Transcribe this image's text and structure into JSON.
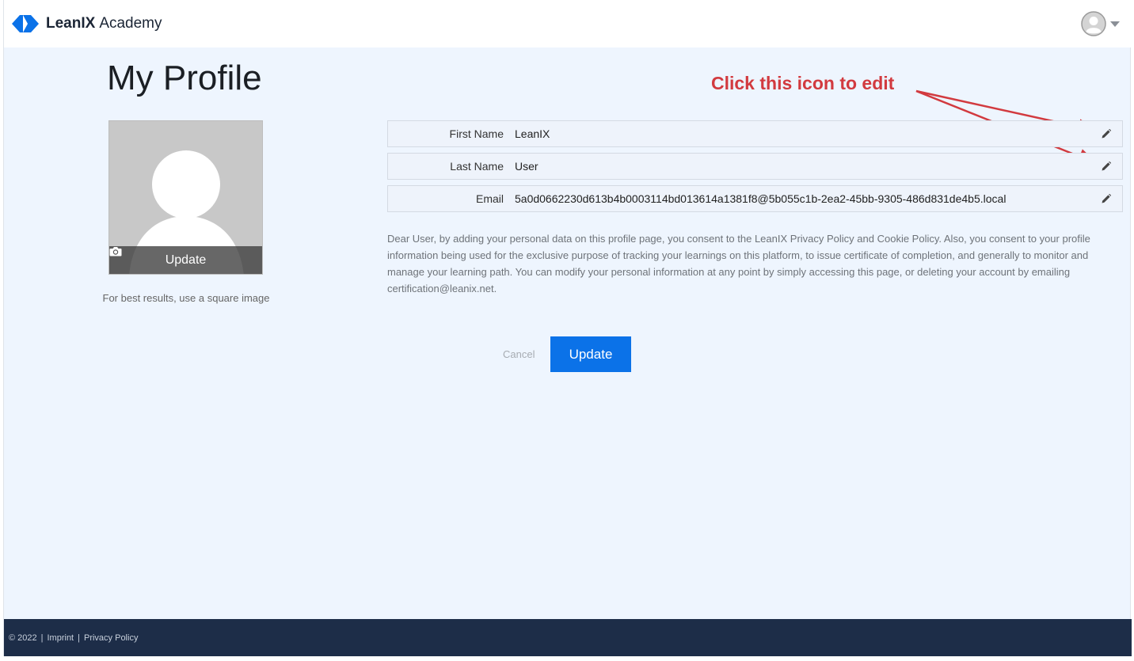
{
  "colors": {
    "brand_blue": "#0b72e8",
    "page_bg": "#eef5fe",
    "footer_bg": "#1d2d48",
    "annotation_red": "#d23a3f"
  },
  "header": {
    "brand_strong": "LeanIX",
    "brand_light": "Academy",
    "logo_icon": "leanix-logo-icon",
    "avatar_icon": "user-avatar-icon",
    "menu_icon": "caret-down-icon"
  },
  "page": {
    "title": "My Profile"
  },
  "photo": {
    "update_label": "Update",
    "camera_icon": "camera-icon",
    "hint": "For best results, use a square image"
  },
  "annotation": {
    "text": "Click this icon to edit"
  },
  "fields": [
    {
      "label": "First Name",
      "value": "LeanIX",
      "edit_icon": "pencil-icon"
    },
    {
      "label": "Last Name",
      "value": "User",
      "edit_icon": "pencil-icon"
    },
    {
      "label": "Email",
      "value": "5a0d0662230d613b4b0003114bd013614a1381f8@5b055c1b-2ea2-45bb-9305-486d831de4b5.local",
      "edit_icon": "pencil-icon"
    }
  ],
  "consent_text": "Dear User, by adding your personal data on this profile page, you consent to the LeanIX Privacy Policy and Cookie Policy. Also, you consent to your profile information being used for the exclusive purpose of tracking your learnings on this platform, to issue certificate of completion, and generally to monitor and manage your learning path. You can modify your personal information at any point by simply accessing this page, or deleting your account by emailing certification@leanix.net.",
  "actions": {
    "cancel_label": "Cancel",
    "update_label": "Update"
  },
  "footer": {
    "copyright": "© 2022",
    "separator": "|",
    "imprint": "Imprint",
    "privacy": "Privacy Policy"
  }
}
